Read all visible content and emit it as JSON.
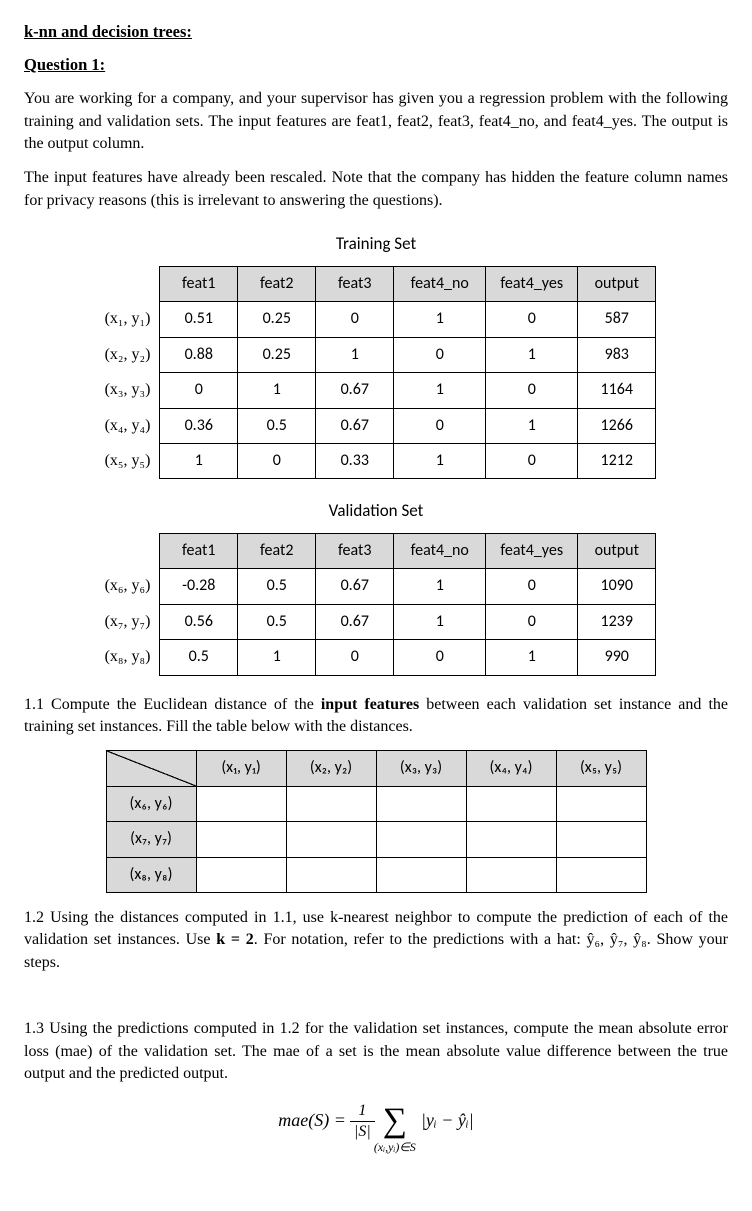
{
  "heading": "k-nn and decision trees:",
  "subheading": "Question 1:",
  "para1": "You are working for a company, and your supervisor has given you a regression problem with the following training and validation sets. The input features are feat1, feat2, feat3, feat4_no, and feat4_yes. The output is the output column.",
  "para2": "The input features have already been rescaled. Note that the company has hidden the feature column names for privacy reasons (this is irrelevant to answering the questions).",
  "training": {
    "title": "Training Set",
    "headers": [
      "feat1",
      "feat2",
      "feat3",
      "feat4_no",
      "feat4_yes",
      "output"
    ],
    "rowLabels": [
      "(x₁, y₁)",
      "(x₂, y₂)",
      "(x₃, y₃)",
      "(x₄, y₄)",
      "(x₅, y₅)"
    ],
    "rows": [
      [
        "0.51",
        "0.25",
        "0",
        "1",
        "0",
        "587"
      ],
      [
        "0.88",
        "0.25",
        "1",
        "0",
        "1",
        "983"
      ],
      [
        "0",
        "1",
        "0.67",
        "1",
        "0",
        "1164"
      ],
      [
        "0.36",
        "0.5",
        "0.67",
        "0",
        "1",
        "1266"
      ],
      [
        "1",
        "0",
        "0.33",
        "1",
        "0",
        "1212"
      ]
    ]
  },
  "validation": {
    "title": "Validation Set",
    "headers": [
      "feat1",
      "feat2",
      "feat3",
      "feat4_no",
      "feat4_yes",
      "output"
    ],
    "rowLabels": [
      "(x₆, y₆)",
      "(x₇, y₇)",
      "(x₈, y₈)"
    ],
    "rows": [
      [
        "-0.28",
        "0.5",
        "0.67",
        "1",
        "0",
        "1090"
      ],
      [
        "0.56",
        "0.5",
        "0.67",
        "1",
        "0",
        "1239"
      ],
      [
        "0.5",
        "1",
        "0",
        "0",
        "1",
        "990"
      ]
    ]
  },
  "q11_pre": "1.1 Compute the Euclidean distance of the ",
  "q11_bold": "input features",
  "q11_post": " between each validation set instance and the training set instances. Fill the table below with the distances.",
  "dist": {
    "colLabels": [
      "(x₁, y₁)",
      "(x₂, y₂)",
      "(x₃, y₃)",
      "(x₄, y₄)",
      "(x₅, y₅)"
    ],
    "rowLabels": [
      "(x₆, y₆)",
      "(x₇, y₇)",
      "(x₈, y₈)"
    ]
  },
  "q12_a": "1.2 Using the distances computed in 1.1, use k-nearest neighbor to compute the prediction of each of the validation set instances. Use ",
  "q12_b": "k = 2",
  "q12_c": ". For notation, refer to the predictions with a hat: ",
  "q12_d": ". Show your steps.",
  "q12_hats": "ŷ₆, ŷ₇, ŷ₈",
  "q13": "1.3 Using the predictions computed in 1.2 for the validation set instances, compute the mean absolute error loss (mae) of the validation set. The mae of a set is the mean absolute value difference between the true output and the predicted output.",
  "formula": {
    "lhs": "mae(S) =",
    "frac_num": "1",
    "frac_den": "|S|",
    "sum_sub": "(xᵢ,yᵢ)∈S",
    "term": "|yᵢ − ŷᵢ|"
  }
}
